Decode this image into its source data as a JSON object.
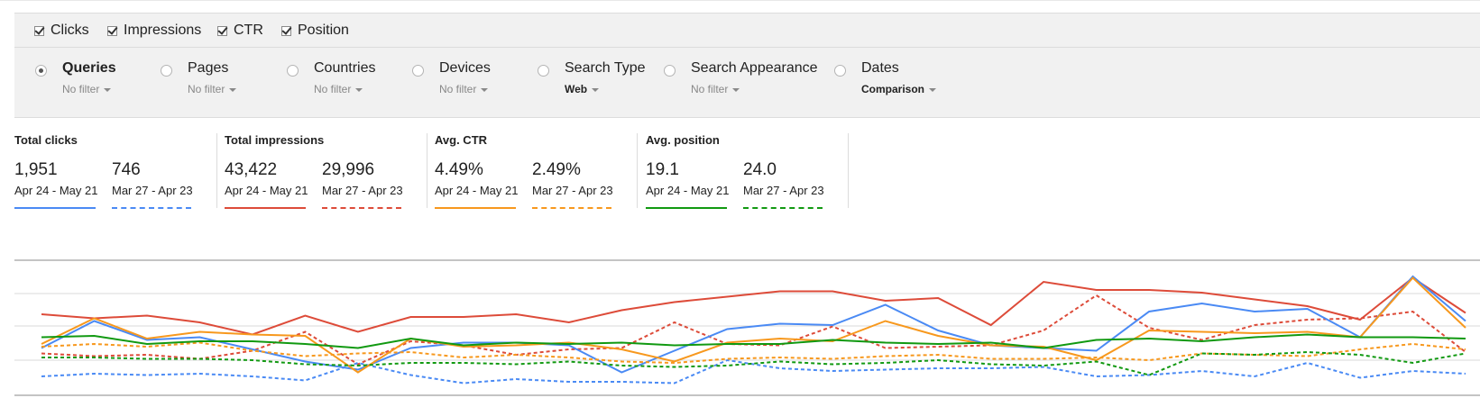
{
  "metrics": [
    {
      "label": "Clicks",
      "checked": true
    },
    {
      "label": "Impressions",
      "checked": true
    },
    {
      "label": "CTR",
      "checked": true
    },
    {
      "label": "Position",
      "checked": true
    }
  ],
  "dimensions": [
    {
      "label": "Queries",
      "filter": "No filter",
      "selected": true
    },
    {
      "label": "Pages",
      "filter": "No filter",
      "selected": false
    },
    {
      "label": "Countries",
      "filter": "No filter",
      "selected": false
    },
    {
      "label": "Devices",
      "filter": "No filter",
      "selected": false
    },
    {
      "label": "Search Type",
      "filter": "Web",
      "selected": false
    },
    {
      "label": "Search Appearance",
      "filter": "No filter",
      "selected": false
    },
    {
      "label": "Dates",
      "filter": "Comparison",
      "selected": false
    }
  ],
  "summary": [
    {
      "title": "Total clicks",
      "current": "1,951",
      "previous": "746",
      "current_range": "Apr 24 - May 21",
      "previous_range": "Mar 27 - Apr 23",
      "color": "#4a8af4"
    },
    {
      "title": "Total impressions",
      "current": "43,422",
      "previous": "29,996",
      "current_range": "Apr 24 - May 21",
      "previous_range": "Mar 27 - Apr 23",
      "color": "#dd4b39"
    },
    {
      "title": "Avg. CTR",
      "current": "4.49%",
      "previous": "2.49%",
      "current_range": "Apr 24 - May 21",
      "previous_range": "Mar 27 - Apr 23",
      "color": "#f7981d"
    },
    {
      "title": "Avg. position",
      "current": "19.1",
      "previous": "24.0",
      "current_range": "Apr 24 - May 21",
      "previous_range": "Mar 27 - Apr 23",
      "color": "#119911"
    }
  ],
  "chart_data": {
    "type": "line",
    "x": [
      1,
      2,
      3,
      4,
      5,
      6,
      7,
      8,
      9,
      10,
      11,
      12,
      13,
      14,
      15,
      16,
      17,
      18,
      19,
      20,
      21,
      22,
      23,
      24,
      25,
      26,
      27,
      28
    ],
    "axis_labels_shown": false,
    "grid": true,
    "series": [
      {
        "color": "#dd4b39",
        "style": "solid",
        "values": [
          60,
          57,
          59,
          54,
          45,
          59,
          47,
          58,
          58,
          60,
          54,
          63,
          69,
          73,
          77,
          77,
          70,
          72,
          52,
          84,
          78,
          78,
          76,
          71,
          66,
          56,
          87,
          61
        ]
      },
      {
        "color": "#dd4b39",
        "style": "dashed",
        "values": [
          31,
          29,
          30,
          27,
          33,
          47,
          23,
          40,
          37,
          30,
          34,
          35,
          54,
          38,
          37,
          51,
          35,
          36,
          37,
          48,
          74,
          50,
          41,
          52,
          56,
          57,
          62,
          32
        ]
      },
      {
        "color": "#4a8af4",
        "style": "solid",
        "values": [
          35,
          55,
          41,
          43,
          34,
          25,
          19,
          35,
          39,
          39,
          37,
          17,
          33,
          49,
          53,
          52,
          67,
          48,
          37,
          35,
          33,
          62,
          68,
          62,
          64,
          43,
          88,
          55
        ]
      },
      {
        "color": "#4a8af4",
        "style": "dashed",
        "values": [
          14,
          16,
          15,
          16,
          14,
          11,
          24,
          15,
          9,
          12,
          10,
          10,
          9,
          26,
          20,
          18,
          19,
          20,
          20,
          21,
          14,
          15,
          18,
          14,
          24,
          13,
          18,
          16
        ]
      },
      {
        "color": "#f7981d",
        "style": "solid",
        "values": [
          38,
          57,
          42,
          47,
          45,
          44,
          17,
          42,
          36,
          37,
          39,
          34,
          25,
          39,
          42,
          40,
          55,
          44,
          37,
          36,
          26,
          48,
          47,
          46,
          47,
          43,
          87,
          50
        ]
      },
      {
        "color": "#f7981d",
        "style": "dashed",
        "values": [
          36,
          38,
          36,
          39,
          33,
          29,
          31,
          32,
          28,
          30,
          28,
          25,
          24,
          27,
          28,
          27,
          29,
          30,
          27,
          27,
          28,
          26,
          31,
          30,
          29,
          34,
          38,
          34
        ]
      },
      {
        "color": "#119911",
        "style": "solid",
        "values": [
          43,
          44,
          38,
          40,
          40,
          38,
          35,
          42,
          37,
          39,
          38,
          39,
          37,
          38,
          38,
          41,
          39,
          38,
          39,
          35,
          41,
          42,
          40,
          43,
          45,
          43,
          43,
          42
        ]
      },
      {
        "color": "#119911",
        "style": "dashed",
        "values": [
          28,
          28,
          27,
          27,
          26,
          23,
          22,
          24,
          24,
          23,
          25,
          22,
          21,
          22,
          25,
          23,
          24,
          26,
          23,
          22,
          25,
          15,
          31,
          30,
          32,
          30,
          24,
          31
        ]
      }
    ]
  }
}
